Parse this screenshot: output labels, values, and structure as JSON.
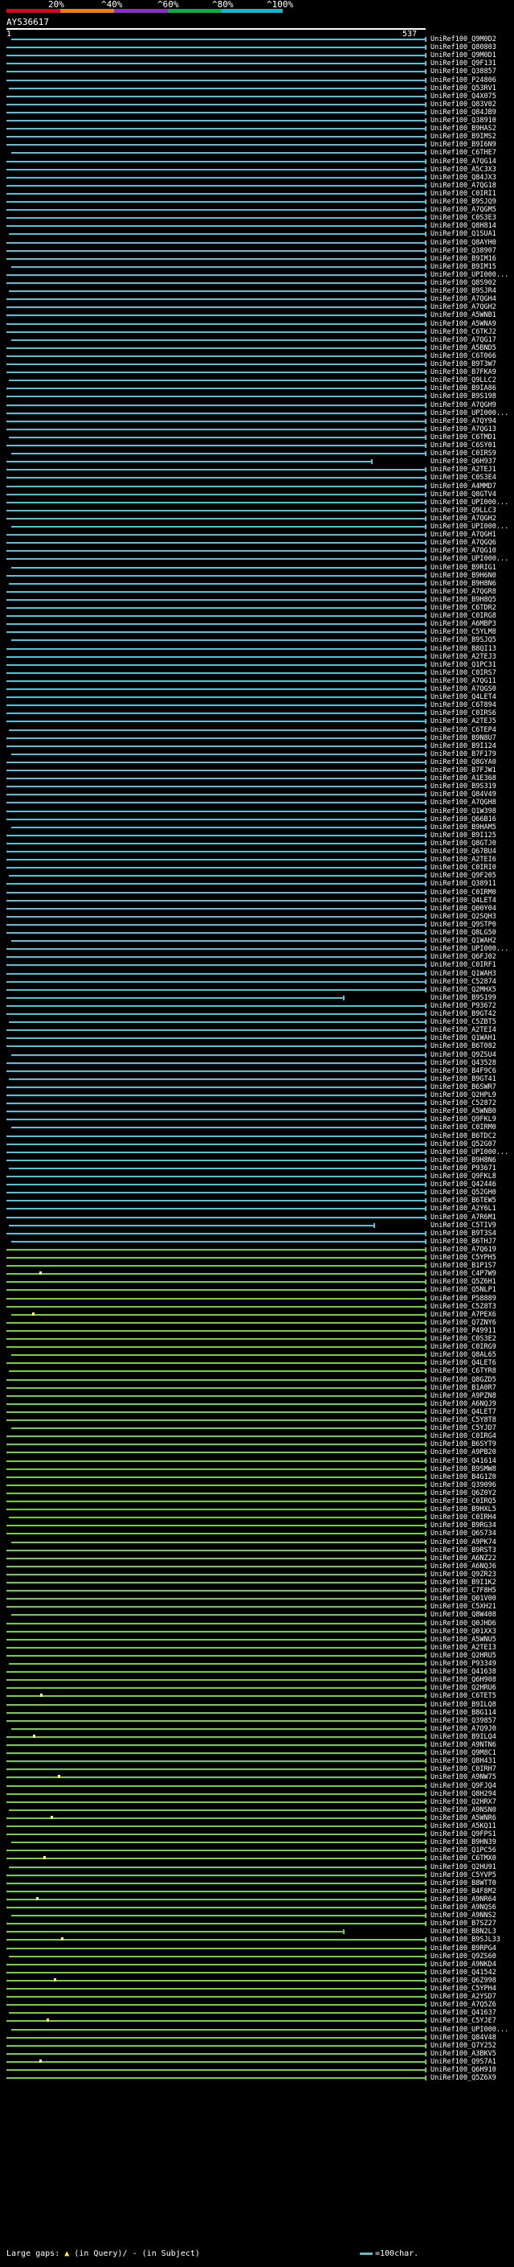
{
  "scale": {
    "labels": [
      "20%",
      "^40%",
      "^60%",
      "^80%",
      "^100%"
    ],
    "colors": [
      "#e0001b",
      "#ff7a00",
      "#8b2bd0",
      "#00b33c",
      "#00bcd4"
    ]
  },
  "query": {
    "name": "AY536617",
    "start": "1",
    "end": "537"
  },
  "bar_colors": {
    "cyan": "#4fc3d9",
    "green": "#6fd13a",
    "gap_marker": "#ffff66"
  },
  "hits": [
    "UniRef100_Q9M0D2",
    "UniRef100_Q80803",
    "UniRef100_Q9M0D1",
    "UniRef100_Q9F131",
    "UniRef100_Q38857",
    "UniRef100_P24806",
    "UniRef100_Q53RV1",
    "UniRef100_Q4X075",
    "UniRef100_Q83V02",
    "UniRef100_Q84JB9",
    "UniRef100_Q38910",
    "UniRef100_B9HAS2",
    "UniRef100_B9IMS2",
    "UniRef100_B9I6N9",
    "UniRef100_C6THE7",
    "UniRef100_A7QG14",
    "UniRef100_A5C3X3",
    "UniRef100_Q84JX3",
    "UniRef100_A7QG18",
    "UniRef100_C0IRI1",
    "UniRef100_B9SJQ9",
    "UniRef100_A7QGM5",
    "UniRef100_C0S3E3",
    "UniRef100_Q8H814",
    "UniRef100_Q1SUA1",
    "UniRef100_Q8AYH0",
    "UniRef100_Q38907",
    "UniRef100_B9IM16",
    "UniRef100_B9IM15",
    "UniRef100_UPI000...",
    "UniRef100_Q8S902",
    "UniRef100_B9SJR4",
    "UniRef100_A7QGH4",
    "UniRef100_A7QGH2",
    "UniRef100_A5WNB1",
    "UniRef100_A5WNA9",
    "UniRef100_C6TKJ2",
    "UniRef100_A7QG17",
    "UniRef100_A5BND5",
    "UniRef100_C6T066",
    "UniRef100_B9T3W7",
    "UniRef100_B7FKA9",
    "UniRef100_Q9LLC2",
    "UniRef100_B9IA86",
    "UniRef100_B9S198",
    "UniRef100_A7QGH9",
    "UniRef100_UPI000...",
    "UniRef100_A7QY94",
    "UniRef100_A7QG13",
    "UniRef100_C6TMD1",
    "UniRef100_C6SY01",
    "UniRef100_C0IRS9",
    "UniRef100_Q6H937",
    "UniRef100_A2TEJ1",
    "UniRef100_C0S3E4",
    "UniRef100_A4MMD7",
    "UniRef100_Q8GTV4",
    "UniRef100_UPI000...",
    "UniRef100_Q9LLC3",
    "UniRef100_A7QGH2",
    "UniRef100_UPI000...",
    "UniRef100_A7QGH1",
    "UniRef100_A7QGQ6",
    "UniRef100_A7QG10",
    "UniRef100_UPI000...",
    "UniRef100_B9RIG1",
    "UniRef100_B9H6N0",
    "UniRef100_B9H8N6",
    "UniRef100_A7QGR8",
    "UniRef100_B9H8Q5",
    "UniRef100_C6TDR2",
    "UniRef100_C0IRG8",
    "UniRef100_A6MBP3",
    "UniRef100_C5YLM8",
    "UniRef100_B9SJQ5",
    "UniRef100_B8QI13",
    "UniRef100_A2TEJ3",
    "UniRef100_Q1PC31",
    "UniRef100_C0IRS7",
    "UniRef100_A7QG11",
    "UniRef100_A7QGS0",
    "UniRef100_Q4LET4",
    "UniRef100_C6T894",
    "UniRef100_C0IRS6",
    "UniRef100_A2TEJ5",
    "UniRef100_C6TEP4",
    "UniRef100_B9N8U7",
    "UniRef100_B9I124",
    "UniRef100_B7F179",
    "UniRef100_Q8GYA0",
    "UniRef100_B7FJW1",
    "UniRef100_A1E368",
    "UniRef100_B9S319",
    "UniRef100_Q84V49",
    "UniRef100_A7QGH8",
    "UniRef100_Q1W398",
    "UniRef100_Q66B16",
    "UniRef100_B9HAM5",
    "UniRef100_B9I125",
    "UniRef100_Q8GTJ0",
    "UniRef100_Q67BU4",
    "UniRef100_A2TEI6",
    "UniRef100_C0IRI0",
    "UniRef100_Q9F205",
    "UniRef100_Q38911",
    "UniRef100_C0IRM0",
    "UniRef100_Q4LET4",
    "UniRef100_Q00Y04",
    "UniRef100_Q2SQH3",
    "UniRef100_Q9STP0",
    "UniRef100_Q8LG50",
    "UniRef100_Q1WAH2",
    "UniRef100_UPI000...",
    "UniRef100_Q6FJ02",
    "UniRef100_C0IRF1",
    "UniRef100_Q1WAH3",
    "UniRef100_C52874",
    "UniRef100_Q2MHX5",
    "UniRef100_B9S199",
    "UniRef100_P93672",
    "UniRef100_B9GT42",
    "UniRef100_C5ZBT5",
    "UniRef100_A2TEI4",
    "UniRef100_Q1WAH1",
    "UniRef100_B6T082",
    "UniRef100_Q9ZSU4",
    "UniRef100_Q43528",
    "UniRef100_B4F9C6",
    "UniRef100_B9GT41",
    "UniRef100_B6SWR7",
    "UniRef100_Q2HPL9",
    "UniRef100_C52872",
    "UniRef100_A5WNB0",
    "UniRef100_Q9FKL9",
    "UniRef100_C0IRM0",
    "UniRef100_B6TDC2",
    "UniRef100_Q52G07",
    "UniRef100_UPI000...",
    "UniRef100_B9H8N6",
    "UniRef100_P93671",
    "UniRef100_Q9FKL8",
    "UniRef100_Q42446",
    "UniRef100_Q52GH0",
    "UniRef100_B6TEW5",
    "UniRef100_A2Y6L1",
    "UniRef100_A7R6M1",
    "UniRef100_C5TIV9",
    "UniRef100_B9T3S4",
    "UniRef100_B6THJ7",
    "UniRef100_A7Q619",
    "UniRef100_C5YPH5",
    "UniRef100_B1P1S7",
    "UniRef100_C4P7W9",
    "UniRef100_Q5Z6H1",
    "UniRef100_Q5NLP1",
    "UniRef100_P58889",
    "UniRef100_C5Z8T3",
    "UniRef100_A7PEX6",
    "UniRef100_Q7ZNY6",
    "UniRef100_P49911",
    "UniRef100_C0S3E2",
    "UniRef100_C0IRG9",
    "UniRef100_Q8AL65",
    "UniRef100_Q4LET6",
    "UniRef100_C6TYR8",
    "UniRef100_Q8GZD5",
    "UniRef100_B1A0R7",
    "UniRef100_A9PZN8",
    "UniRef100_A6NQJ9",
    "UniRef100_Q4LET7",
    "UniRef100_C5Y8T8",
    "UniRef100_C5YJD7",
    "UniRef100_C0IRG4",
    "UniRef100_B6SYT9",
    "UniRef100_A9PB20",
    "UniRef100_Q41614",
    "UniRef100_B9SMW8",
    "UniRef100_B4G1Z0",
    "UniRef100_Q39096",
    "UniRef100_Q6Z0Y2",
    "UniRef100_C0IRQ5",
    "UniRef100_B9HXL5",
    "UniRef100_C0IRH4",
    "UniRef100_B9RG34",
    "UniRef100_Q6S734",
    "UniRef100_A9PK74",
    "UniRef100_B9RST3",
    "UniRef100_A6NZ22",
    "UniRef100_A6NQJ6",
    "UniRef100_Q9ZR23",
    "UniRef100_B9I1K2",
    "UniRef100_C7F8H5",
    "UniRef100_Q01V00",
    "UniRef100_C5XH21",
    "UniRef100_Q8W408",
    "UniRef100_Q0JHD6",
    "UniRef100_Q01XX3",
    "UniRef100_A5WNU5",
    "UniRef100_A2TEI3",
    "UniRef100_Q2HRU5",
    "UniRef100_P93349",
    "UniRef100_Q41638",
    "UniRef100_Q6H908",
    "UniRef100_Q2HRU6",
    "UniRef100_C6TET5",
    "UniRef100_B9ILQ8",
    "UniRef100_B8G114",
    "UniRef100_Q39857",
    "UniRef100_A7Q9J0",
    "UniRef100_B9ILQ4",
    "UniRef100_A9NTN6",
    "UniRef100_Q9M8C1",
    "UniRef100_Q8H431",
    "UniRef100_C0IRH7",
    "UniRef100_A9NW75",
    "UniRef100_Q9FJQ4",
    "UniRef100_Q8H294",
    "UniRef100_Q2HRX7",
    "UniRef100_A9NSN0",
    "UniRef100_A5WNR6",
    "UniRef100_A5KQ11",
    "UniRef100_Q9FPS1",
    "UniRef100_B9HN39",
    "UniRef100_Q1PC56",
    "UniRef100_C6TMX0",
    "UniRef100_Q2HU91",
    "UniRef100_C5YVP5",
    "UniRef100_B8WTT0",
    "UniRef100_B4F8M2",
    "UniRef100_A9NR64",
    "UniRef100_A9NQS6",
    "UniRef100_A9NNS2",
    "UniRef100_B7SZ27",
    "UniRef100_B8N2L3",
    "UniRef100_B9SJL33",
    "UniRef100_B9RPG4",
    "UniRef100_Q9ZS60",
    "UniRef100_A9NKD4",
    "UniRef100_Q41542",
    "UniRef100_Q6Z998",
    "UniRef100_C5YPH4",
    "UniRef100_A2YSD7",
    "UniRef100_A7Q5Z6",
    "UniRef100_Q41637",
    "UniRef100_C5YJE7",
    "UniRef100_UPI000...",
    "UniRef100_Q84V48",
    "UniRef100_Q7Y252",
    "UniRef100_A3BKV5",
    "UniRef100_Q9S7A1",
    "UniRef100_Q6H910",
    "UniRef100_Q5Z6X9"
  ],
  "footer": {
    "label": "Large gaps:",
    "gap_in_query": "(in Query)/",
    "gap_in_subject": "(in Subject)",
    "scale_label": "=100char."
  }
}
